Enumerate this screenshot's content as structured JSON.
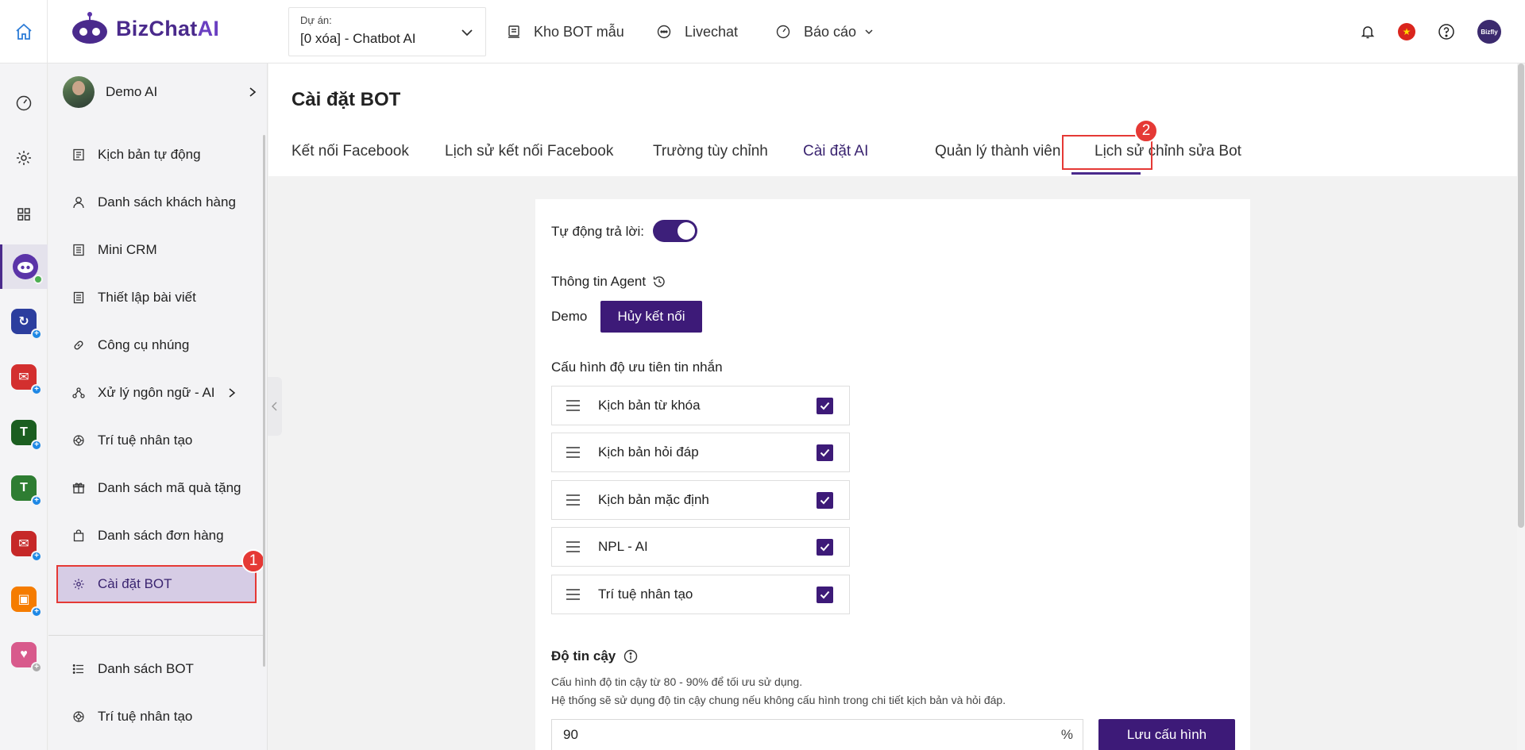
{
  "brand": {
    "name_a": "BizChat",
    "name_b": "AI"
  },
  "project": {
    "label": "Dự án:",
    "value": "[0 xóa] - Chatbot AI"
  },
  "topnav": [
    {
      "label": "Kho BOT mẫu",
      "icon": "template-icon"
    },
    {
      "label": "Livechat",
      "icon": "chat-icon"
    },
    {
      "label": "Báo cáo",
      "icon": "dashboard-icon"
    }
  ],
  "top_right": {
    "avatar_text": "Bizfly"
  },
  "sidebar": {
    "user": {
      "name": "Demo AI"
    },
    "items": [
      {
        "label": "Kịch bản tự động",
        "icon": "script-icon"
      },
      {
        "label": "Danh sách khách hàng",
        "icon": "user-icon"
      },
      {
        "label": "Mini CRM",
        "icon": "crm-icon"
      },
      {
        "label": "Thiết lập bài viết",
        "icon": "post-icon"
      },
      {
        "label": "Công cụ nhúng",
        "icon": "link-icon"
      },
      {
        "label": "Xử lý ngôn ngữ - AI",
        "icon": "nlp-icon"
      },
      {
        "label": "Trí tuệ nhân tạo",
        "icon": "ai-icon"
      },
      {
        "label": "Danh sách mã quà tặng",
        "icon": "gift-icon"
      },
      {
        "label": "Danh sách đơn hàng",
        "icon": "bag-icon"
      },
      {
        "label": "Cài đặt BOT",
        "icon": "gear-icon"
      }
    ],
    "bottom_items": [
      {
        "label": "Danh sách BOT",
        "icon": "list-icon"
      },
      {
        "label": "Trí tuệ nhân tạo",
        "icon": "ai-icon"
      }
    ]
  },
  "annotations": {
    "step1": "1",
    "step2": "2"
  },
  "page": {
    "title": "Cài đặt BOT"
  },
  "tabs": [
    {
      "label": "Kết nối Facebook"
    },
    {
      "label": "Lịch sử kết nối Facebook"
    },
    {
      "label": "Trường tùy chỉnh"
    },
    {
      "label": "Cài đặt AI"
    },
    {
      "label": "Quản lý thành viên"
    },
    {
      "label": "Lịch sử chỉnh sửa Bot"
    }
  ],
  "settings": {
    "auto_reply_label": "Tự động trả lời:",
    "auto_reply_on": true,
    "agent_title": "Thông tin Agent",
    "agent_name": "Demo",
    "disconnect_label": "Hủy kết nối",
    "priority_title": "Cấu hình độ ưu tiên tin nhắn",
    "priority": [
      {
        "label": "Kịch bản từ khóa",
        "checked": true
      },
      {
        "label": "Kịch bản hỏi đáp",
        "checked": true
      },
      {
        "label": "Kịch bản mặc định",
        "checked": true
      },
      {
        "label": "NPL - AI",
        "checked": true
      },
      {
        "label": "Trí tuệ nhân tạo",
        "checked": true
      }
    ],
    "confidence_title": "Độ tin cậy",
    "confidence_hint1": "Cấu hình độ tin cậy từ 80 - 90% để tối ưu sử dụng.",
    "confidence_hint2": "Hệ thống sẽ sử dụng độ tin cậy chung nếu không cấu hình trong chi tiết kịch bản và hỏi đáp.",
    "confidence_value": "90",
    "confidence_unit": "%",
    "save_label": "Lưu cấu hình"
  },
  "colors": {
    "brand": "#4a2a8c",
    "primary_button": "#3d1a78",
    "highlight": "#e53935"
  }
}
